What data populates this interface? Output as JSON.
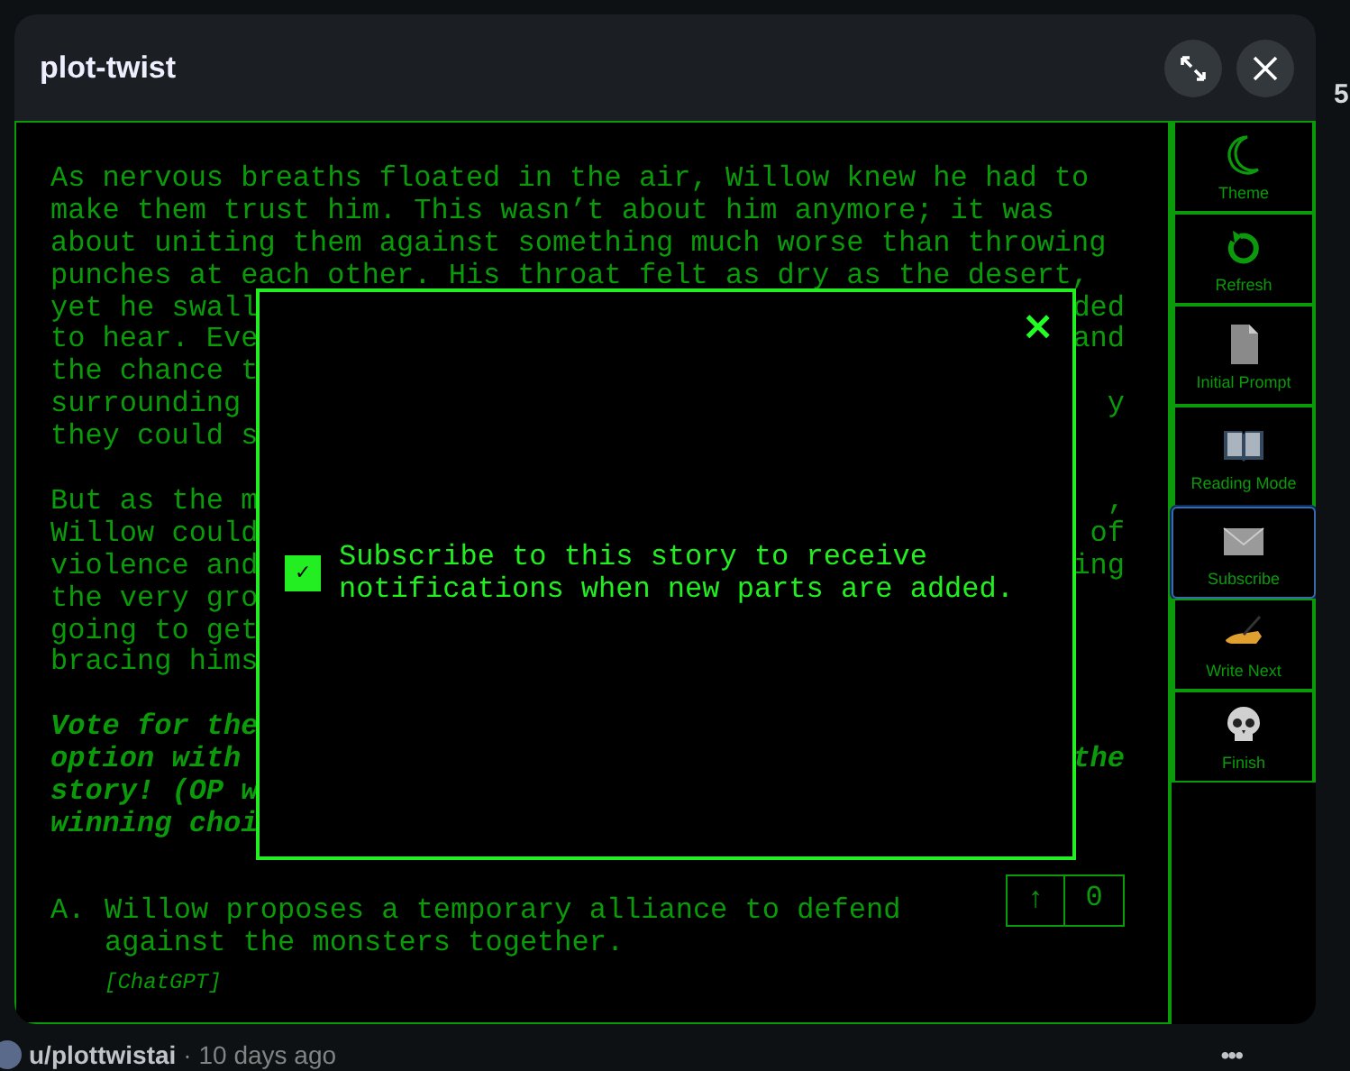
{
  "background_page": {
    "side_fragments": [
      "5"
    ],
    "post_meta": {
      "author": "u/plottwistai",
      "separator": "·",
      "time": "10 days ago"
    },
    "more": "•••"
  },
  "window": {
    "title": "plot-twist"
  },
  "story": {
    "paragraphs": [
      {
        "kind": "text",
        "lines": [
          {
            "left": "As nervous breaths floated in the air, Willow knew he had to"
          },
          {
            "left": "make them trust him. This wasn’t about him anymore; it was"
          },
          {
            "left": "about uniting them against something much worse than throwing"
          },
          {
            "left": "punches at each other. His throat felt as dry as the desert,"
          },
          {
            "left": "yet he swall",
            "right": "ded"
          },
          {
            "left": "to hear. Eve",
            "right": "and"
          },
          {
            "left": "the chance t"
          },
          {
            "left": "surrounding",
            "right": "y"
          },
          {
            "left": "they could s"
          }
        ]
      },
      {
        "kind": "text",
        "lines": [
          {
            "left": "But as the m",
            "right": ","
          },
          {
            "left": "Willow could",
            "right": "of"
          },
          {
            "left": "violence and",
            "right": "ing"
          },
          {
            "left": "the very gro"
          },
          {
            "left": "going to get"
          },
          {
            "left": "bracing hims"
          }
        ]
      },
      {
        "kind": "vote_prompt",
        "lines": [
          {
            "left": "Vote for the"
          },
          {
            "left": "option with",
            "right": "the"
          },
          {
            "left": "story! (OP w"
          },
          {
            "left": "winning choi"
          }
        ]
      }
    ]
  },
  "choices": [
    {
      "label": "A.",
      "lines": [
        "Willow proposes a temporary alliance to defend",
        "against the monsters together."
      ],
      "source": "[ChatGPT]",
      "upvote": "↑",
      "votes": "0"
    }
  ],
  "sidebar": {
    "items": [
      {
        "label": "Theme",
        "kind": "moon",
        "selected": false
      },
      {
        "label": "Refresh",
        "kind": "refresh",
        "selected": false
      },
      {
        "label": "Initial Prompt",
        "kind": "page",
        "selected": false
      },
      {
        "label": "Reading Mode",
        "kind": "book",
        "selected": false
      },
      {
        "label": "Subscribe",
        "kind": "envelope",
        "selected": true
      },
      {
        "label": "Write Next",
        "kind": "hand",
        "selected": false
      },
      {
        "label": "Finish",
        "kind": "skull",
        "selected": false
      }
    ]
  },
  "dialog": {
    "close": "×",
    "subscribe": {
      "checked": true,
      "check_glyph": "✓",
      "text": "Subscribe to this story to receive notifications when new parts are added."
    }
  }
}
